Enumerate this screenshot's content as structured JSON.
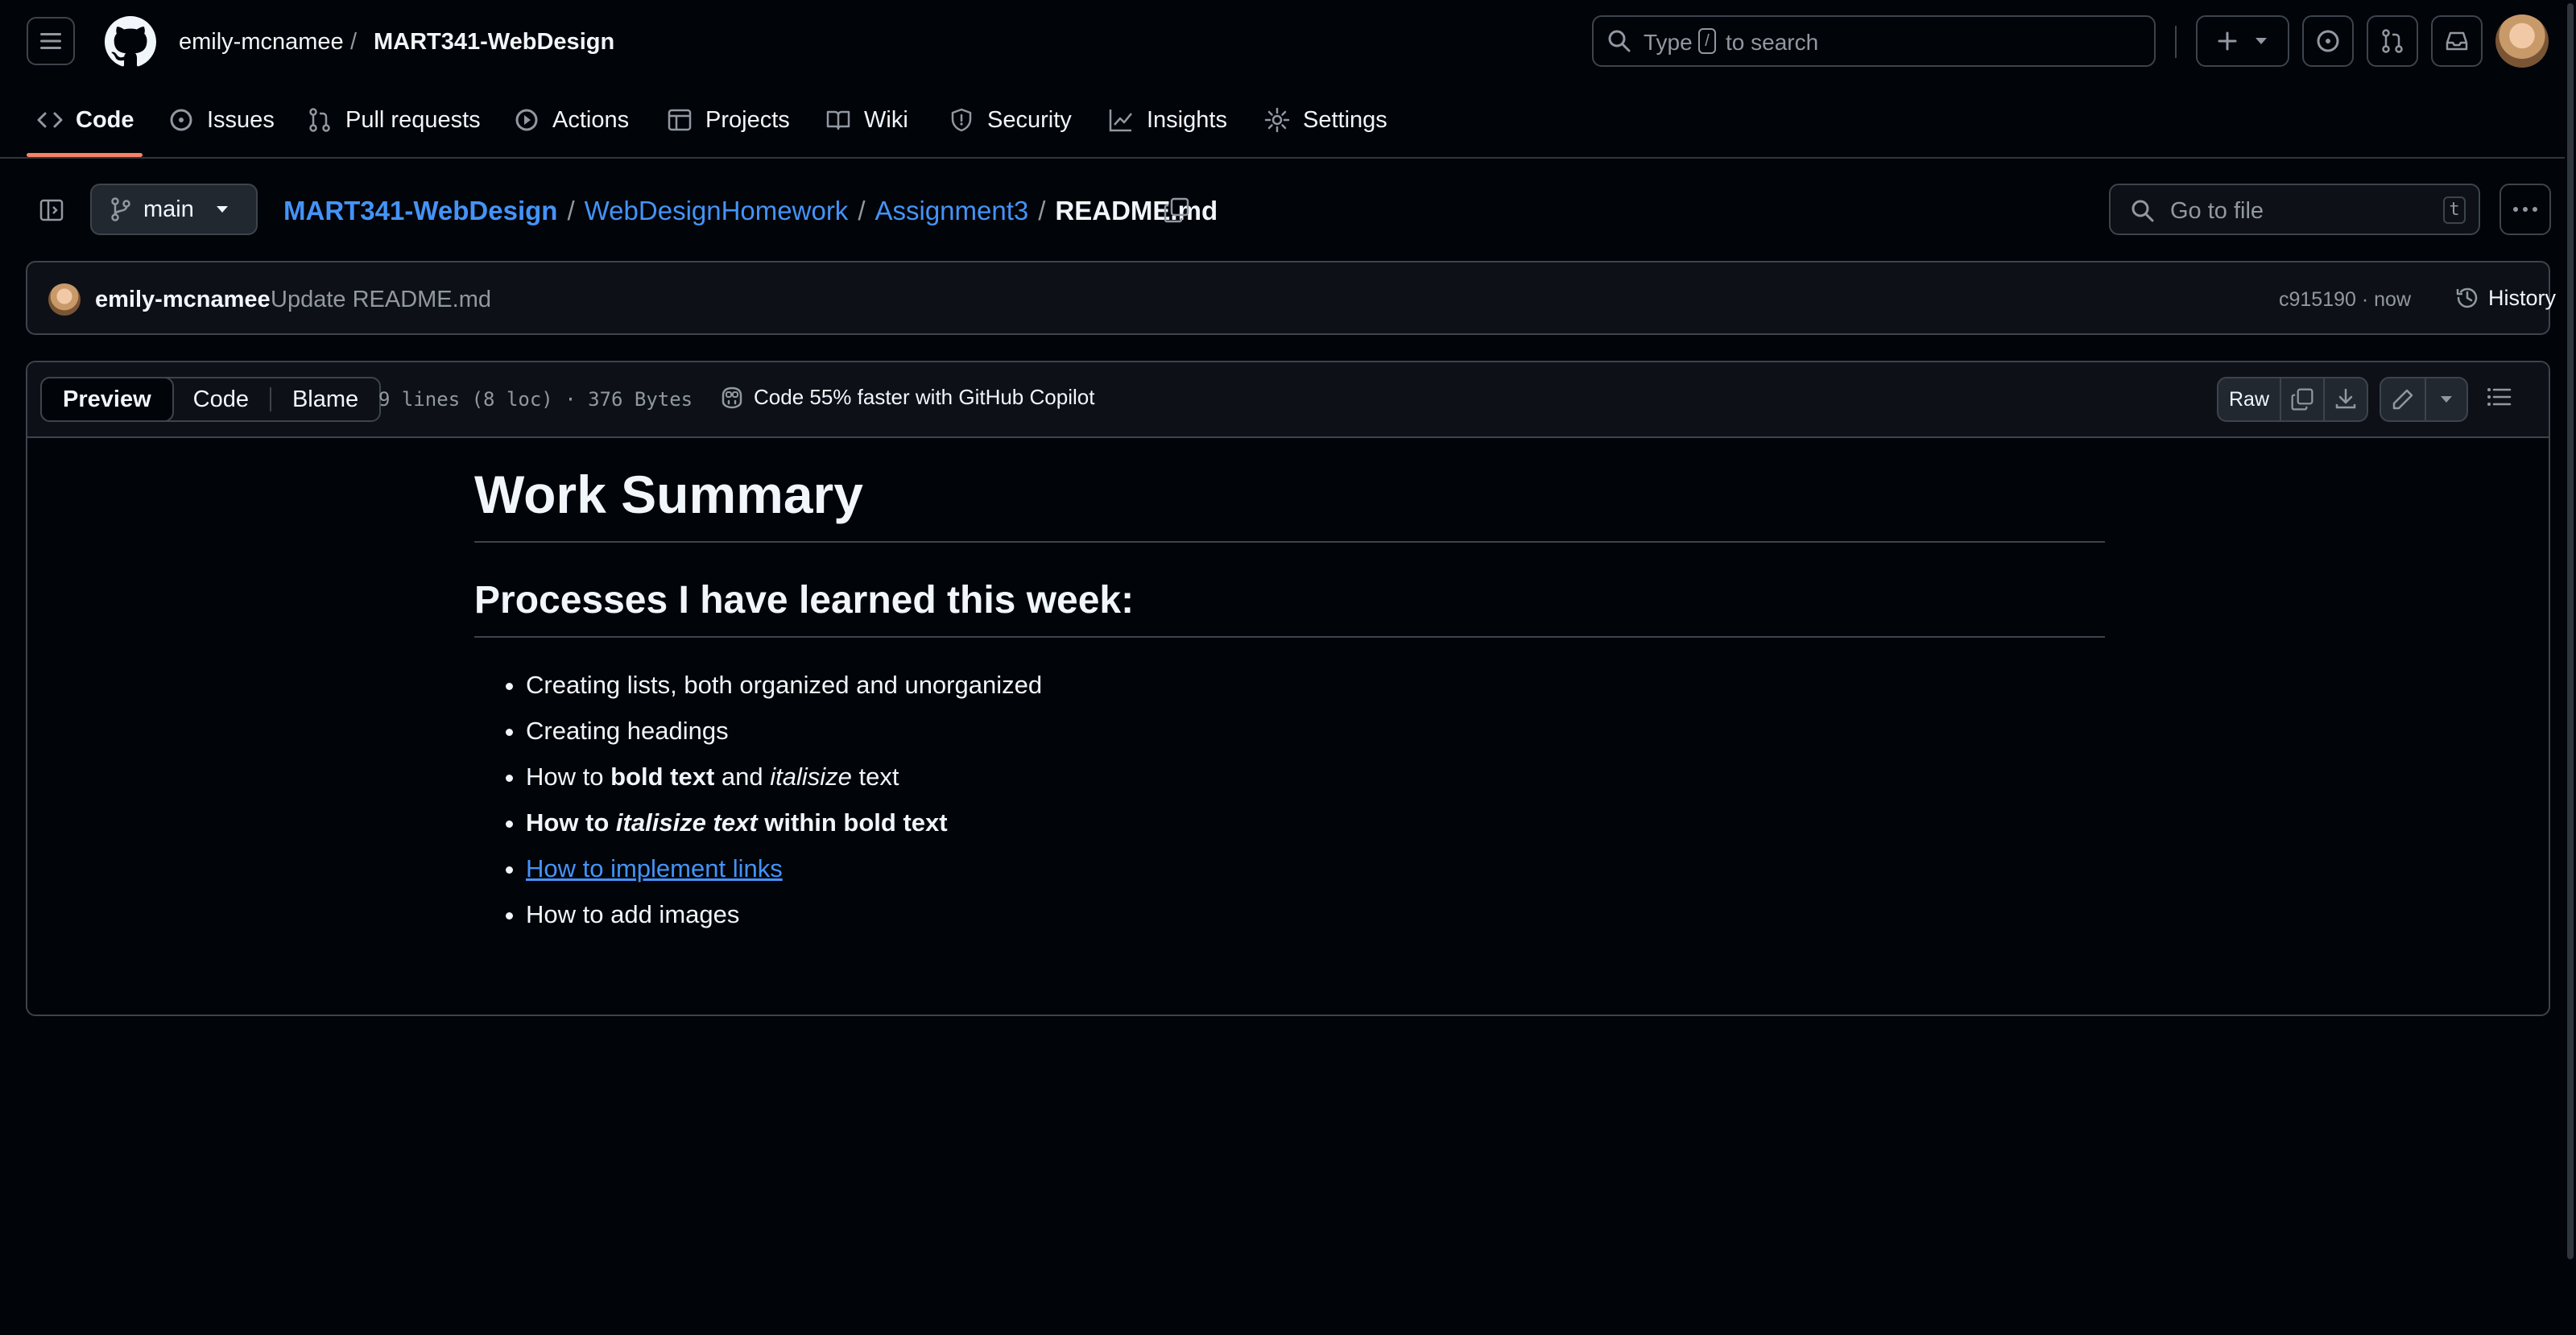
{
  "header": {
    "owner": "emily-mcnamee",
    "separator": "/",
    "repo": "MART341-WebDesign",
    "search": {
      "prefix": "Type",
      "key": "/",
      "suffix": "to search"
    }
  },
  "nav": {
    "tabs": [
      {
        "label": "Code",
        "icon": "code-icon",
        "active": true
      },
      {
        "label": "Issues",
        "icon": "issue-icon"
      },
      {
        "label": "Pull requests",
        "icon": "pull-request-icon"
      },
      {
        "label": "Actions",
        "icon": "play-icon"
      },
      {
        "label": "Projects",
        "icon": "table-icon"
      },
      {
        "label": "Wiki",
        "icon": "book-icon"
      },
      {
        "label": "Security",
        "icon": "shield-icon"
      },
      {
        "label": "Insights",
        "icon": "graph-icon"
      },
      {
        "label": "Settings",
        "icon": "gear-icon"
      }
    ],
    "accent": "#f78166"
  },
  "repo_bar": {
    "branch": "main",
    "breadcrumb": {
      "repo": "MART341-WebDesign",
      "folder1": "WebDesignHomework",
      "folder2": "Assignment3",
      "file": "README.md",
      "sep": "/"
    },
    "go_to_file": {
      "placeholder": "Go to file",
      "key": "t"
    }
  },
  "commit": {
    "author": "emily-mcnamee",
    "message": "Update README.md",
    "sha_time": "c915190 · now",
    "history_label": "History"
  },
  "file": {
    "tabs": {
      "preview": "Preview",
      "code": "Code",
      "blame": "Blame"
    },
    "info": "9 lines (8 loc) · 376 Bytes",
    "copilot": "Code 55% faster with GitHub Copilot",
    "raw_label": "Raw"
  },
  "readme": {
    "h1": "Work Summary",
    "h2": "Processes I have learned this week:",
    "items": {
      "i1": "Creating lists, both organized and unorganized",
      "i2": "Creating headings",
      "i3_a": "How to ",
      "i3_b": "bold text",
      "i3_c": " and ",
      "i3_d": "italisize",
      "i3_e": " text",
      "i4_a": "How to ",
      "i4_b": "italisize text",
      "i4_c": " within bold text",
      "i5": "How to implement links",
      "i6": "How to add images"
    },
    "link_color": "#4493f8"
  }
}
